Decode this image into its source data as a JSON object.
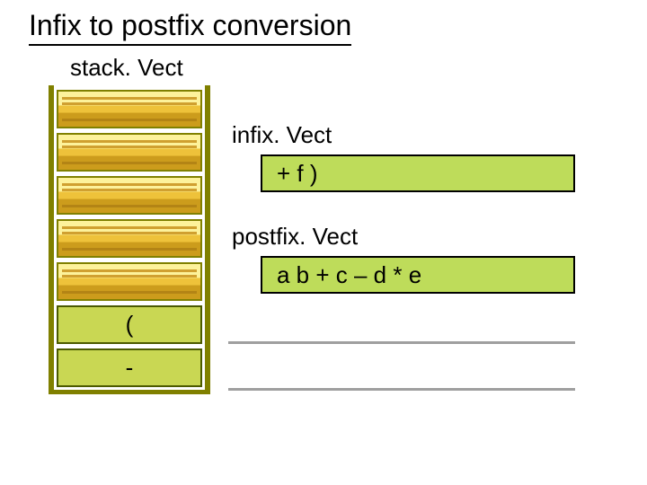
{
  "title": "Infix to postfix conversion",
  "stack": {
    "label": "stack. Vect",
    "slots": [
      {
        "value": "",
        "filled": false
      },
      {
        "value": "",
        "filled": false
      },
      {
        "value": "",
        "filled": false
      },
      {
        "value": "",
        "filled": false
      },
      {
        "value": "",
        "filled": false
      },
      {
        "value": "(",
        "filled": true
      },
      {
        "value": "-",
        "filled": true
      }
    ]
  },
  "infix": {
    "label": "infix. Vect",
    "value": "+ f )"
  },
  "postfix": {
    "label": "postfix. Vect",
    "value": "a b + c – d * e"
  }
}
